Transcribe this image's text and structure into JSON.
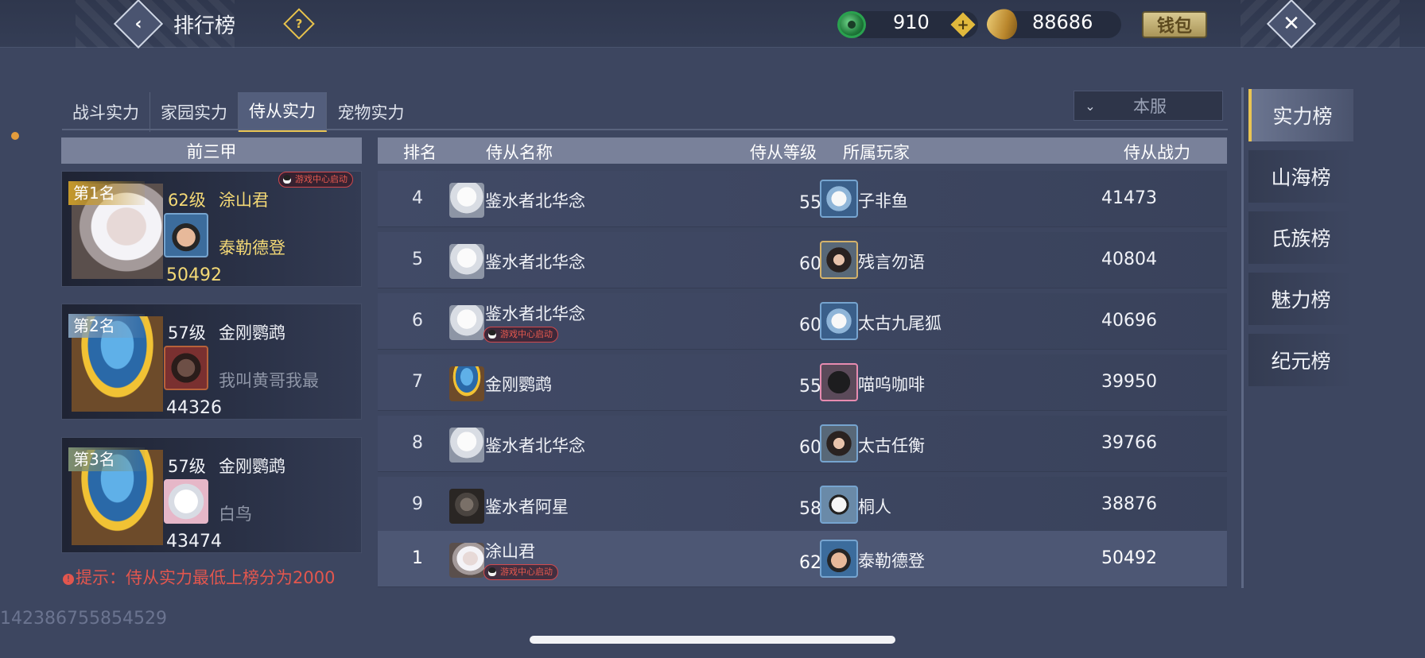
{
  "header": {
    "title": "排行榜",
    "jade": "910",
    "coins": "88686",
    "wallet_label": "钱包"
  },
  "tabs": [
    "战斗实力",
    "家园实力",
    "侍从实力",
    "宠物实力"
  ],
  "server_select": "本服",
  "top3": {
    "header": "前三甲",
    "cards": [
      {
        "rank_label": "第1名",
        "level": "62级",
        "pet_name": "涂山君",
        "owner": "泰勒德登",
        "score": "50492",
        "badge": "游戏中心启动"
      },
      {
        "rank_label": "第2名",
        "level": "57级",
        "pet_name": "金刚鹦鹉",
        "owner": "我叫黄哥我最",
        "score": "44326"
      },
      {
        "rank_label": "第3名",
        "level": "57级",
        "pet_name": "金刚鹦鹉",
        "owner": "白鸟",
        "score": "43474"
      }
    ]
  },
  "hint": "提示：侍从实力最低上榜分为2000",
  "uid": "142386755854529",
  "table": {
    "headers": {
      "rank": "排名",
      "name": "侍从名称",
      "level": "侍从等级",
      "owner": "所属玩家",
      "power": "侍从战力"
    },
    "rows": [
      {
        "rank": "4",
        "name": "鉴水者北华念",
        "level": "55级",
        "owner": "子非鱼",
        "power": "41473"
      },
      {
        "rank": "5",
        "name": "鉴水者北华念",
        "level": "60级",
        "owner": "残言勿语",
        "power": "40804"
      },
      {
        "rank": "6",
        "name": "鉴水者北华念",
        "badge": "游戏中心启动",
        "level": "60级",
        "owner": "太古九尾狐",
        "power": "40696"
      },
      {
        "rank": "7",
        "name": "金刚鹦鹉",
        "level": "55级",
        "owner": "喵呜咖啡",
        "power": "39950"
      },
      {
        "rank": "8",
        "name": "鉴水者北华念",
        "level": "60级",
        "owner": "太古任衡",
        "power": "39766"
      },
      {
        "rank": "9",
        "name": "鉴水者阿星",
        "level": "58级",
        "owner": "桐人",
        "power": "38876"
      }
    ],
    "my_row": {
      "rank": "1",
      "name": "涂山君",
      "badge": "游戏中心启动",
      "level": "62级",
      "owner": "泰勒德登",
      "power": "50492"
    }
  },
  "right_nav": [
    "实力榜",
    "山海榜",
    "氏族榜",
    "魅力榜",
    "纪元榜"
  ],
  "colors": {
    "background": "#3d4660",
    "gold_text": "#f4d976",
    "hint_red": "#e2564e",
    "active_accent": "#e9c453"
  }
}
